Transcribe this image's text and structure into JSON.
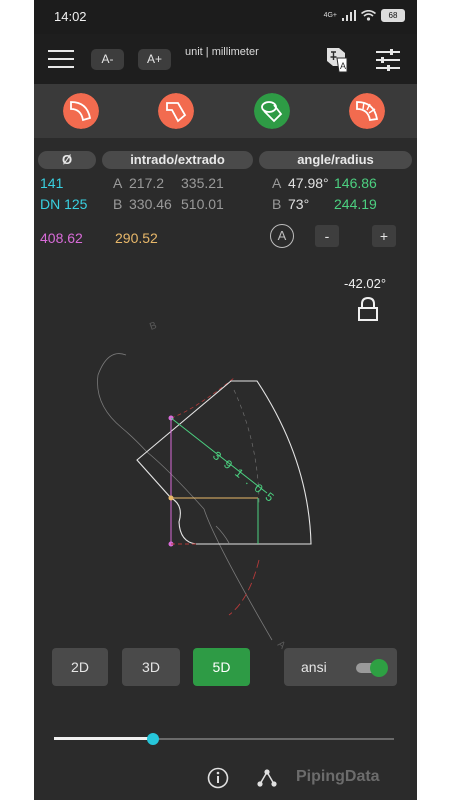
{
  "status_bar": {
    "time": "14:02",
    "network": "4G+",
    "battery": "68"
  },
  "toolbar": {
    "font_decrease_label": "A-",
    "font_increase_label": "A+",
    "unit_label": "unit | millimeter",
    "icons": [
      "menu-icon",
      "language-icon",
      "settings-sliders-icon"
    ]
  },
  "fitting_types": [
    {
      "name": "elbow-90-icon",
      "color": "#f26b4f"
    },
    {
      "name": "elbow-45-icon",
      "color": "#f26b4f"
    },
    {
      "name": "mitered-elbow-icon",
      "color": "#2e9b45",
      "selected": true
    },
    {
      "name": "segmented-elbow-icon",
      "color": "#f26b4f"
    }
  ],
  "headers": {
    "diameter": "Ø",
    "intrado_extrado": "intrado/extrado",
    "angle_radius": "angle/radius"
  },
  "values": {
    "diameter_mm": "141",
    "nominal_size": "DN 125",
    "row_a_label": "A",
    "row_a_intrado": "217.2",
    "row_a_extrado": "335.21",
    "row_b_label": "B",
    "row_b_intrado": "330.46",
    "row_b_extrado": "510.01",
    "angle_a_label": "A",
    "angle_a": "47.98°",
    "radius_a": "146.86",
    "angle_b_label": "B",
    "angle_b": "73°",
    "radius_b": "244.19",
    "length_pink": "408.62",
    "length_yellow": "290.52"
  },
  "controls": {
    "select_a_label": "A",
    "minus_label": "-",
    "plus_label": "+"
  },
  "rotation_readout": "-42.02°",
  "drawing": {
    "center_dimension": "3 9 1 . 0 5",
    "label_a": "A",
    "label_b": "B"
  },
  "view_buttons": [
    {
      "label": "2D",
      "active": false
    },
    {
      "label": "3D",
      "active": false
    },
    {
      "label": "5D",
      "active": true
    }
  ],
  "standard_toggle": {
    "label": "ansi",
    "on": true
  },
  "slider": {
    "value_fraction": 0.29
  },
  "footer": {
    "brand": "PipingData"
  },
  "colors": {
    "background": "#2b2b2b",
    "accent_green": "#2e9b45",
    "accent_orange": "#f26b4f",
    "cyan": "#39d0e0",
    "green_text": "#4cd080",
    "pink": "#d86bd8",
    "yellow": "#e8b86a"
  }
}
